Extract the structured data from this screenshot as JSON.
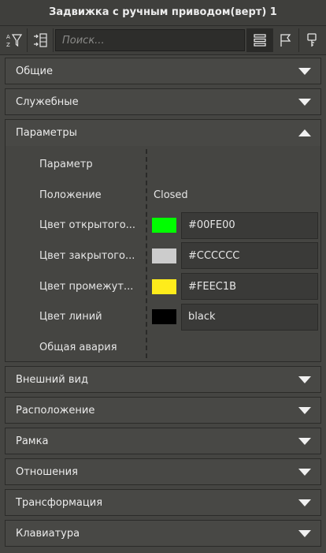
{
  "window": {
    "title": "Задвижка с ручным приводом(верт) 1"
  },
  "toolbar": {
    "search_placeholder": "Поиск...",
    "left_icons": [
      "filter-az-icon",
      "collapse-arrows-icon"
    ],
    "right_icons": [
      "list-view-icon",
      "flag-icon",
      "key-icon"
    ]
  },
  "sections": {
    "general": {
      "label": "Общие"
    },
    "service": {
      "label": "Служебные"
    },
    "params": {
      "label": "Параметры"
    },
    "appearance": {
      "label": "Внешний вид"
    },
    "location": {
      "label": "Расположение"
    },
    "frame": {
      "label": "Рамка"
    },
    "relations": {
      "label": "Отношения"
    },
    "transform": {
      "label": "Трансформация"
    },
    "keyboard": {
      "label": "Клавиатура"
    }
  },
  "params": {
    "rows": [
      {
        "name": "Параметр",
        "value": ""
      },
      {
        "name": "Положение",
        "value": "Closed"
      },
      {
        "name": "Цвет открытого...",
        "value": "#00FE00",
        "swatch": "#00FE00"
      },
      {
        "name": "Цвет закрытого...",
        "value": "#CCCCCC",
        "swatch": "#CCCCCC"
      },
      {
        "name": "Цвет промежут...",
        "value": "#FEEC1B",
        "swatch": "#FEEC1B"
      },
      {
        "name": "Цвет линий",
        "value": "black",
        "swatch": "#000000"
      },
      {
        "name": "Общая авария",
        "value": ""
      }
    ]
  },
  "colors": {
    "background": "#454542",
    "header_bg": "#484845",
    "border": "#2b2b29"
  }
}
